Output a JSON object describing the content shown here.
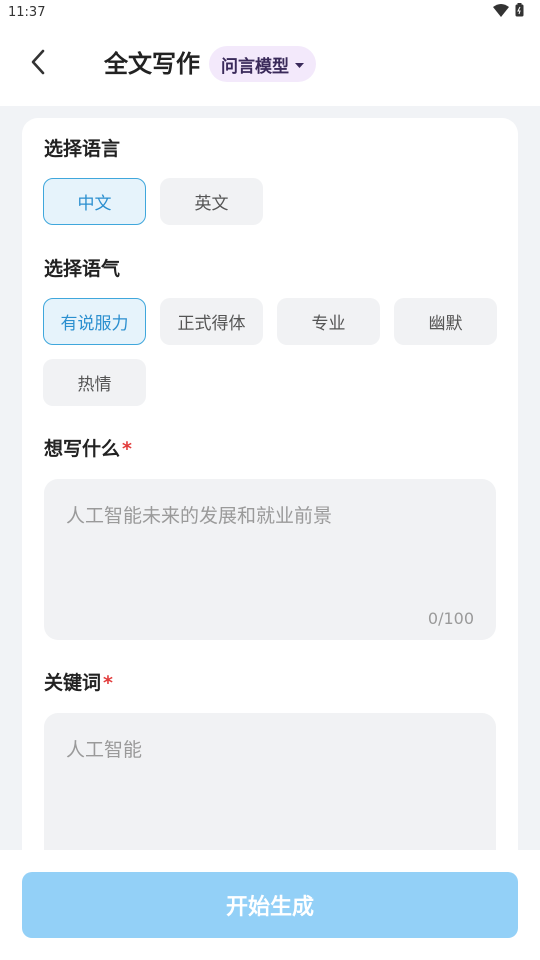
{
  "status_bar": {
    "time": "11:37"
  },
  "header": {
    "title": "全文写作",
    "model_chip": "问言模型"
  },
  "language": {
    "title": "选择语言",
    "options": [
      "中文",
      "英文"
    ],
    "selected": "中文"
  },
  "tone": {
    "title": "选择语气",
    "options": [
      "有说服力",
      "正式得体",
      "专业",
      "幽默",
      "热情"
    ],
    "selected": "有说服力"
  },
  "topic": {
    "title": "想写什么",
    "required_mark": "*",
    "placeholder": "人工智能未来的发展和就业前景",
    "counter": "0/100"
  },
  "keywords": {
    "title": "关键词",
    "required_mark": "*",
    "placeholder": "人工智能"
  },
  "actions": {
    "start": "开始生成"
  },
  "colors": {
    "accent": "#3fa7dc",
    "button_disabled": "#93d0f7",
    "chip_bg": "#f3e9fb",
    "required": "#e23b3b"
  }
}
